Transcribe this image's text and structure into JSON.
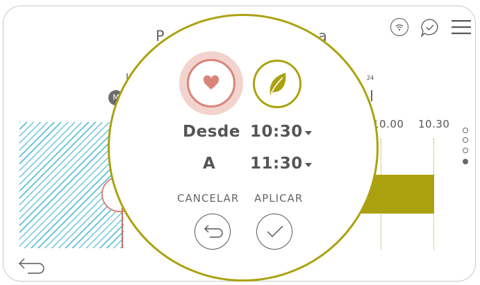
{
  "header": {
    "title_left_fragment": "P",
    "title_right_fragment": "a",
    "icons": [
      "wifi-icon",
      "chat-check-icon",
      "menu-icon"
    ]
  },
  "chart_fragment": {
    "day_small": "24",
    "left_letter": "L",
    "badge": "M",
    "ticks": [
      "10.00",
      "10.30"
    ]
  },
  "popup": {
    "modes": [
      {
        "icon": "heart-icon",
        "selected": true,
        "color": "#d9847a"
      },
      {
        "icon": "leaf-icon",
        "selected": false,
        "color": "#aba10f"
      }
    ],
    "from_label": "Desde",
    "from_value": "10:30",
    "to_label": "A",
    "to_value": "11:30",
    "cancel_label": "CANCELAR",
    "apply_label": "APLICAR"
  },
  "pagination": {
    "count": 4,
    "active_index": 3
  },
  "colors": {
    "accent_olive": "#aba10f",
    "accent_coral": "#d9847a",
    "hatch_blue": "#3ab4cf"
  }
}
